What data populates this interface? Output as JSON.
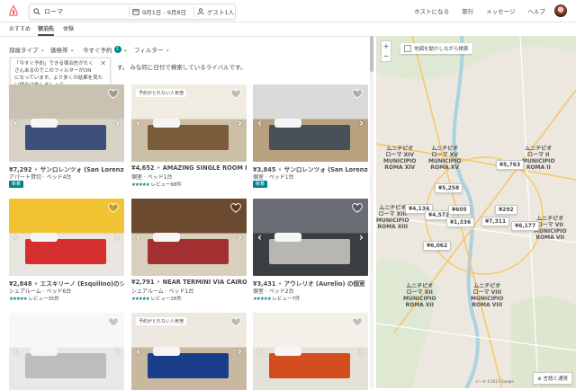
{
  "header": {
    "search_value": "ローマ",
    "dates": "9月1日 - 9月8日",
    "guests": "ゲスト1人",
    "nav": [
      "ホストになる",
      "旅行",
      "メッセージ",
      "ヘルプ"
    ]
  },
  "tabs": [
    "おすすめ",
    "宿泊先",
    "体験"
  ],
  "filters": [
    {
      "label": "部屋タイプ",
      "icon": "chevron-down"
    },
    {
      "label": "価格帯",
      "icon": "chevron-down"
    },
    {
      "label": "今すぐ予約",
      "badge": "1",
      "icon": "chevron-down"
    },
    {
      "label": "フィルター",
      "icon": "chevron-down"
    }
  ],
  "tooltip": {
    "lines": [
      "「今すぐ予約」できる宿泊先がたく",
      "さんあるのでこのフィルターがON",
      "になっています。より多くの結果を見た",
      "い場合は外しましょう。"
    ]
  },
  "help_text": "す。 みな同じ日付で検索しているライバルです。",
  "listings": [
    {
      "title": "¥7,292 ⚡ サンロレンツォ (San Lorenzo)の個",
      "sub": "アパート貸切 · ベッド4台",
      "review": "",
      "new": "新着",
      "tag": ""
    },
    {
      "title": "¥4,652 ⚡ AMAZING SINGLE ROOM NEA…",
      "sub": "個室 · ベッド1台",
      "review": "レビュー68件",
      "new": "",
      "tag": "予約がとれない人気宿"
    },
    {
      "title": "¥3,845 ⚡ サンロレンツォ (San Lorenzo)の個",
      "sub": "個室 · ベッド1台",
      "review": "",
      "new": "新着",
      "tag": ""
    },
    {
      "title": "¥2,848 ⚡ エスキリーノ (Esquilino)のシェ…",
      "sub": "シェアルーム · ベッド6台",
      "review": "レビュー35件",
      "new": "",
      "tag": ""
    },
    {
      "title": "¥2,791 ⚡ NEAR TERMINI VIA CAIROLI 101…",
      "sub": "シェアルーム · ベッド1台",
      "review": "レビュー26件",
      "new": "",
      "tag": ""
    },
    {
      "title": "¥3,431 ⚡ アウレリオ (Aurelio) の個室",
      "sub": "個室 · ベッド2台",
      "review": "レビュー7件",
      "new": "",
      "tag": ""
    },
    {
      "title": "",
      "sub": "",
      "review": "",
      "new": "",
      "tag": ""
    },
    {
      "title": "",
      "sub": "",
      "review": "",
      "new": "",
      "tag": "予約がとれない人気宿"
    },
    {
      "title": "",
      "sub": "",
      "review": "",
      "new": "",
      "tag": ""
    }
  ],
  "map": {
    "checkbox_label": "地図を動かしながら検索",
    "pins": [
      "¥5,763",
      "¥5,258",
      "¥4,134",
      "¥4,572",
      "¥605",
      "¥1,336",
      "¥7,311",
      "¥292",
      "¥6,177",
      "¥6,062"
    ],
    "labels": [
      "ムニチピオ\nローマ XV\nMUNICIPIO\nROMA XV",
      "ムニチピオ\nローマ XIV\nMUNICIPIO\nROMA XIV",
      "ムニチピオ\nローマ II\nMUNICIPIO\nROMA II",
      "ムニチピオ\nローマ XIII\nMUNICIPIO\nROMA XIII",
      "ムニチピオ\nローマ XII\nMUNICIPIO\nROMA XII",
      "ムニチピオ\nローマ VIII\nMUNICIPIO\nROMA VIII",
      "ムニチピオ\nローマ VII\nMUNICIPIO\nROMA VII"
    ],
    "language_button": "言語と通貨",
    "attribution": "データ ©2017 Google"
  },
  "colors": {
    "brand": "#FF5A5F",
    "teal": "#008489"
  }
}
